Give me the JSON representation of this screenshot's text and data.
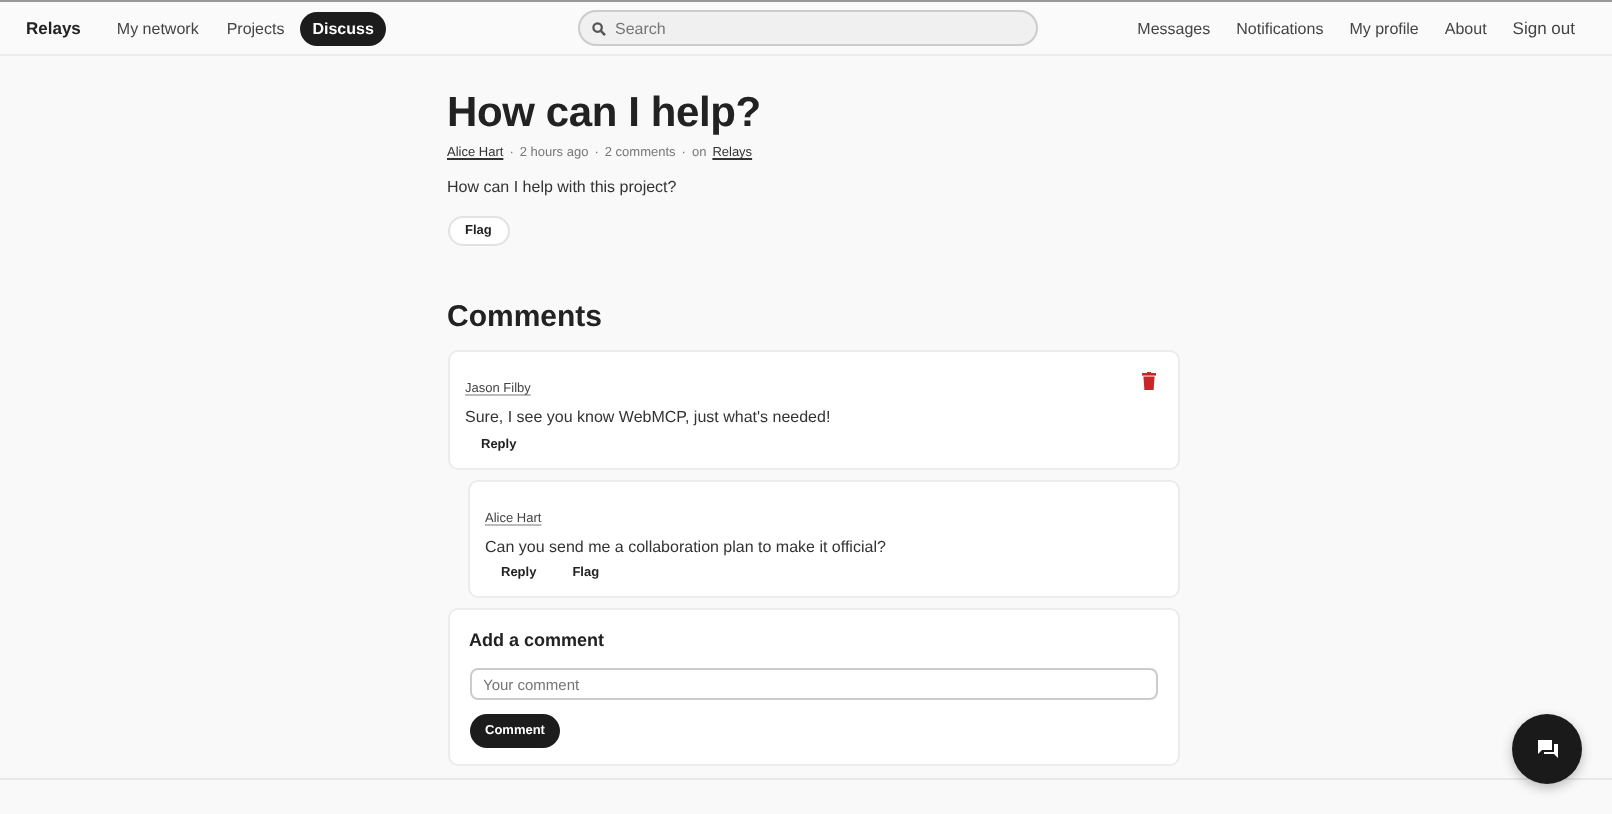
{
  "nav": {
    "brand": "Relays",
    "items": [
      {
        "label": "My network",
        "selected": false
      },
      {
        "label": "Projects",
        "selected": false
      },
      {
        "label": "Discuss",
        "selected": true
      }
    ],
    "search": {
      "placeholder": "Search"
    },
    "right_items": [
      {
        "label": "Messages"
      },
      {
        "label": "Notifications"
      },
      {
        "label": "My profile"
      },
      {
        "label": "About"
      },
      {
        "label": "Sign out"
      }
    ]
  },
  "post": {
    "title": "How can I help?",
    "author": "Alice Hart",
    "time": "2 hours ago",
    "comments_count": "2 comments",
    "separator": "·",
    "on_label": "on",
    "project": "Relays",
    "body": "How can I help with this project?",
    "actions": [
      "Flag"
    ]
  },
  "comments_heading": "Comments",
  "comments": [
    {
      "author": "Jason Filby",
      "text": "Sure, I see you know WebMCP, just what's needed!",
      "actions": [
        "Reply"
      ],
      "deletable": true,
      "nested": false
    },
    {
      "author": "Alice Hart",
      "text": "Can you send me a collaboration plan to make it official?",
      "actions": [
        "Reply",
        "Flag"
      ],
      "deletable": false,
      "nested": true
    }
  ],
  "add_comment": {
    "title": "Add a comment",
    "placeholder": "Your comment",
    "button": "Comment"
  }
}
